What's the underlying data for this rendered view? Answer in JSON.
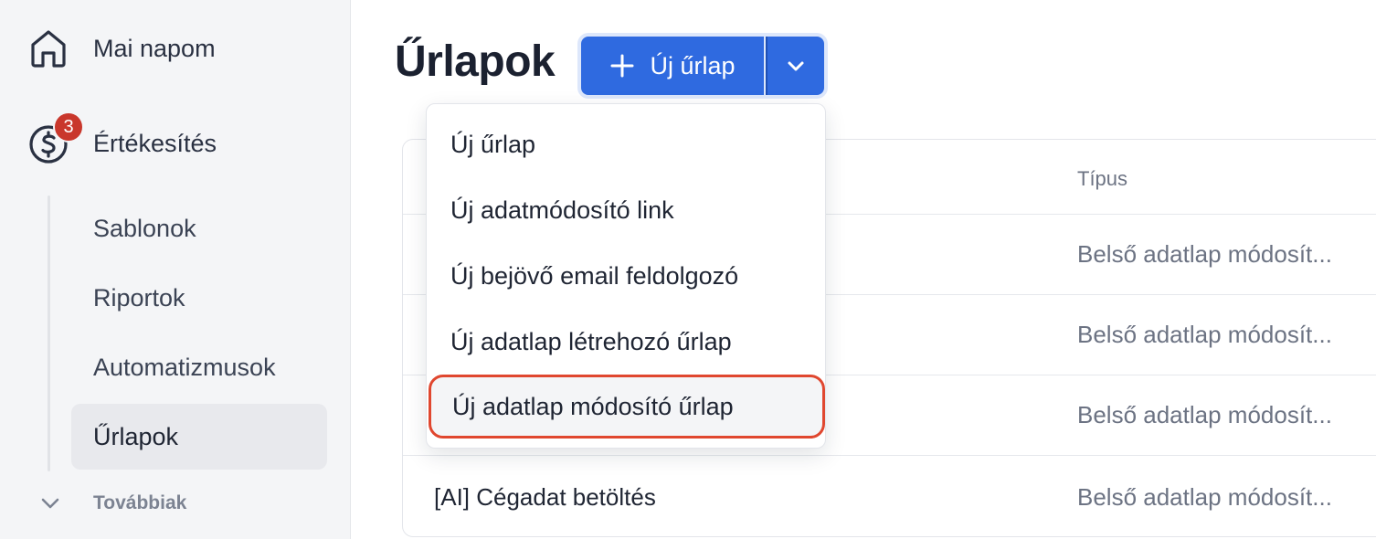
{
  "sidebar": {
    "home": {
      "label": "Mai napom",
      "icon": "home-icon"
    },
    "sales": {
      "label": "Értékesítés",
      "icon": "dollar-circle-icon",
      "badge": "3"
    },
    "items": [
      {
        "label": "Sablonok"
      },
      {
        "label": "Riportok"
      },
      {
        "label": "Automatizmusok"
      },
      {
        "label": "Űrlapok",
        "active": true
      }
    ],
    "more": {
      "label": "Továbbiak",
      "icon": "chevron-down-icon"
    }
  },
  "header": {
    "title": "Űrlapok",
    "new_button_label": "Új űrlap",
    "new_button_icon": "plus-icon",
    "split_icon": "chevron-down-icon"
  },
  "dropdown": {
    "items": [
      {
        "label": "Új űrlap"
      },
      {
        "label": "Új adatmódosító link"
      },
      {
        "label": "Új bejövő email feldolgozó"
      },
      {
        "label": "Új adatlap létrehozó űrlap"
      },
      {
        "label": "Új adatlap módosító űrlap",
        "highlighted": true
      }
    ]
  },
  "table": {
    "columns": {
      "type": "Típus"
    },
    "rows": [
      {
        "name": "",
        "type": "Belső adatlap módosít..."
      },
      {
        "name": "",
        "type": "Belső adatlap módosít..."
      },
      {
        "name": "",
        "type": "Belső adatlap módosít..."
      },
      {
        "name": "[AI] Cégadat betöltés",
        "type": "Belső adatlap módosít..."
      }
    ]
  },
  "colors": {
    "accent": "#2f6ae0",
    "badge": "#c9372c",
    "highlight_border": "#e0472f",
    "sidebar_bg": "#f4f5f7"
  }
}
